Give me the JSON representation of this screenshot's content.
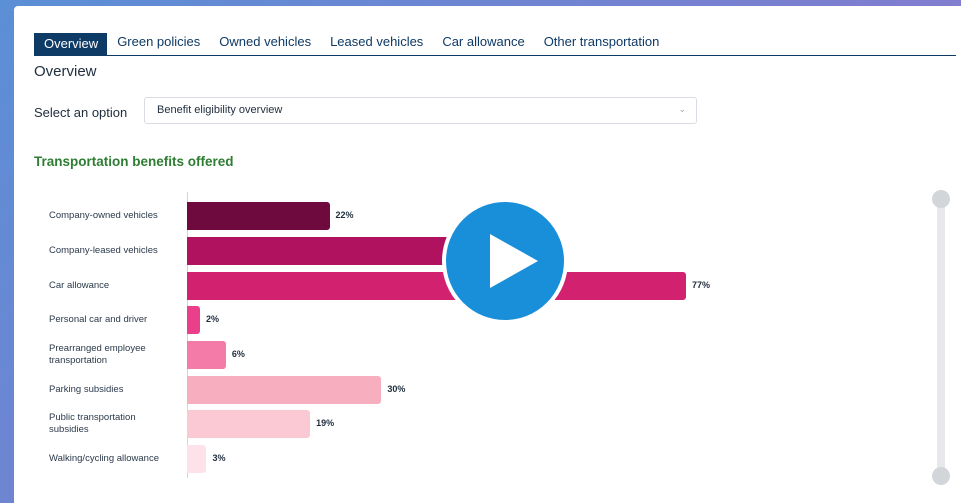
{
  "tabs": [
    {
      "label": "Overview",
      "active": true
    },
    {
      "label": "Green policies",
      "active": false
    },
    {
      "label": "Owned vehicles",
      "active": false
    },
    {
      "label": "Leased vehicles",
      "active": false
    },
    {
      "label": "Car allowance",
      "active": false
    },
    {
      "label": "Other transportation",
      "active": false
    }
  ],
  "page_title": "Overview",
  "select": {
    "label": "Select an option",
    "value": "Benefit eligibility overview"
  },
  "section_title": "Transportation benefits offered",
  "colors": {
    "tab_active": "#0e3a66",
    "section_title": "#2e7d32",
    "play_button": "#1a8fd9",
    "bars": [
      "#6e0a3e",
      "#b0125f",
      "#d2226f",
      "#ea3f8a",
      "#f47aa7",
      "#f7aebf",
      "#fac9d4",
      "#fde3e9"
    ]
  },
  "icons": {
    "play": "play-icon",
    "select_chevron": "chevron-down-icon"
  },
  "chart_data": {
    "type": "bar",
    "orientation": "horizontal",
    "categories": [
      "Company-owned vehicles",
      "Company-leased vehicles",
      "Car allowance",
      "Personal car and driver",
      "Prearranged employee transportation",
      "Parking subsidies",
      "Public transportation subsidies",
      "Walking/cycling allowance"
    ],
    "values": [
      22,
      null,
      77,
      2,
      6,
      30,
      19,
      3
    ],
    "value_labels": [
      "22%",
      "",
      "77%",
      "2%",
      "6%",
      "30%",
      "19%",
      "3%"
    ],
    "value_suffix": "%",
    "title": "Transportation benefits offered",
    "xlim": [
      0,
      100
    ],
    "grid": false
  }
}
